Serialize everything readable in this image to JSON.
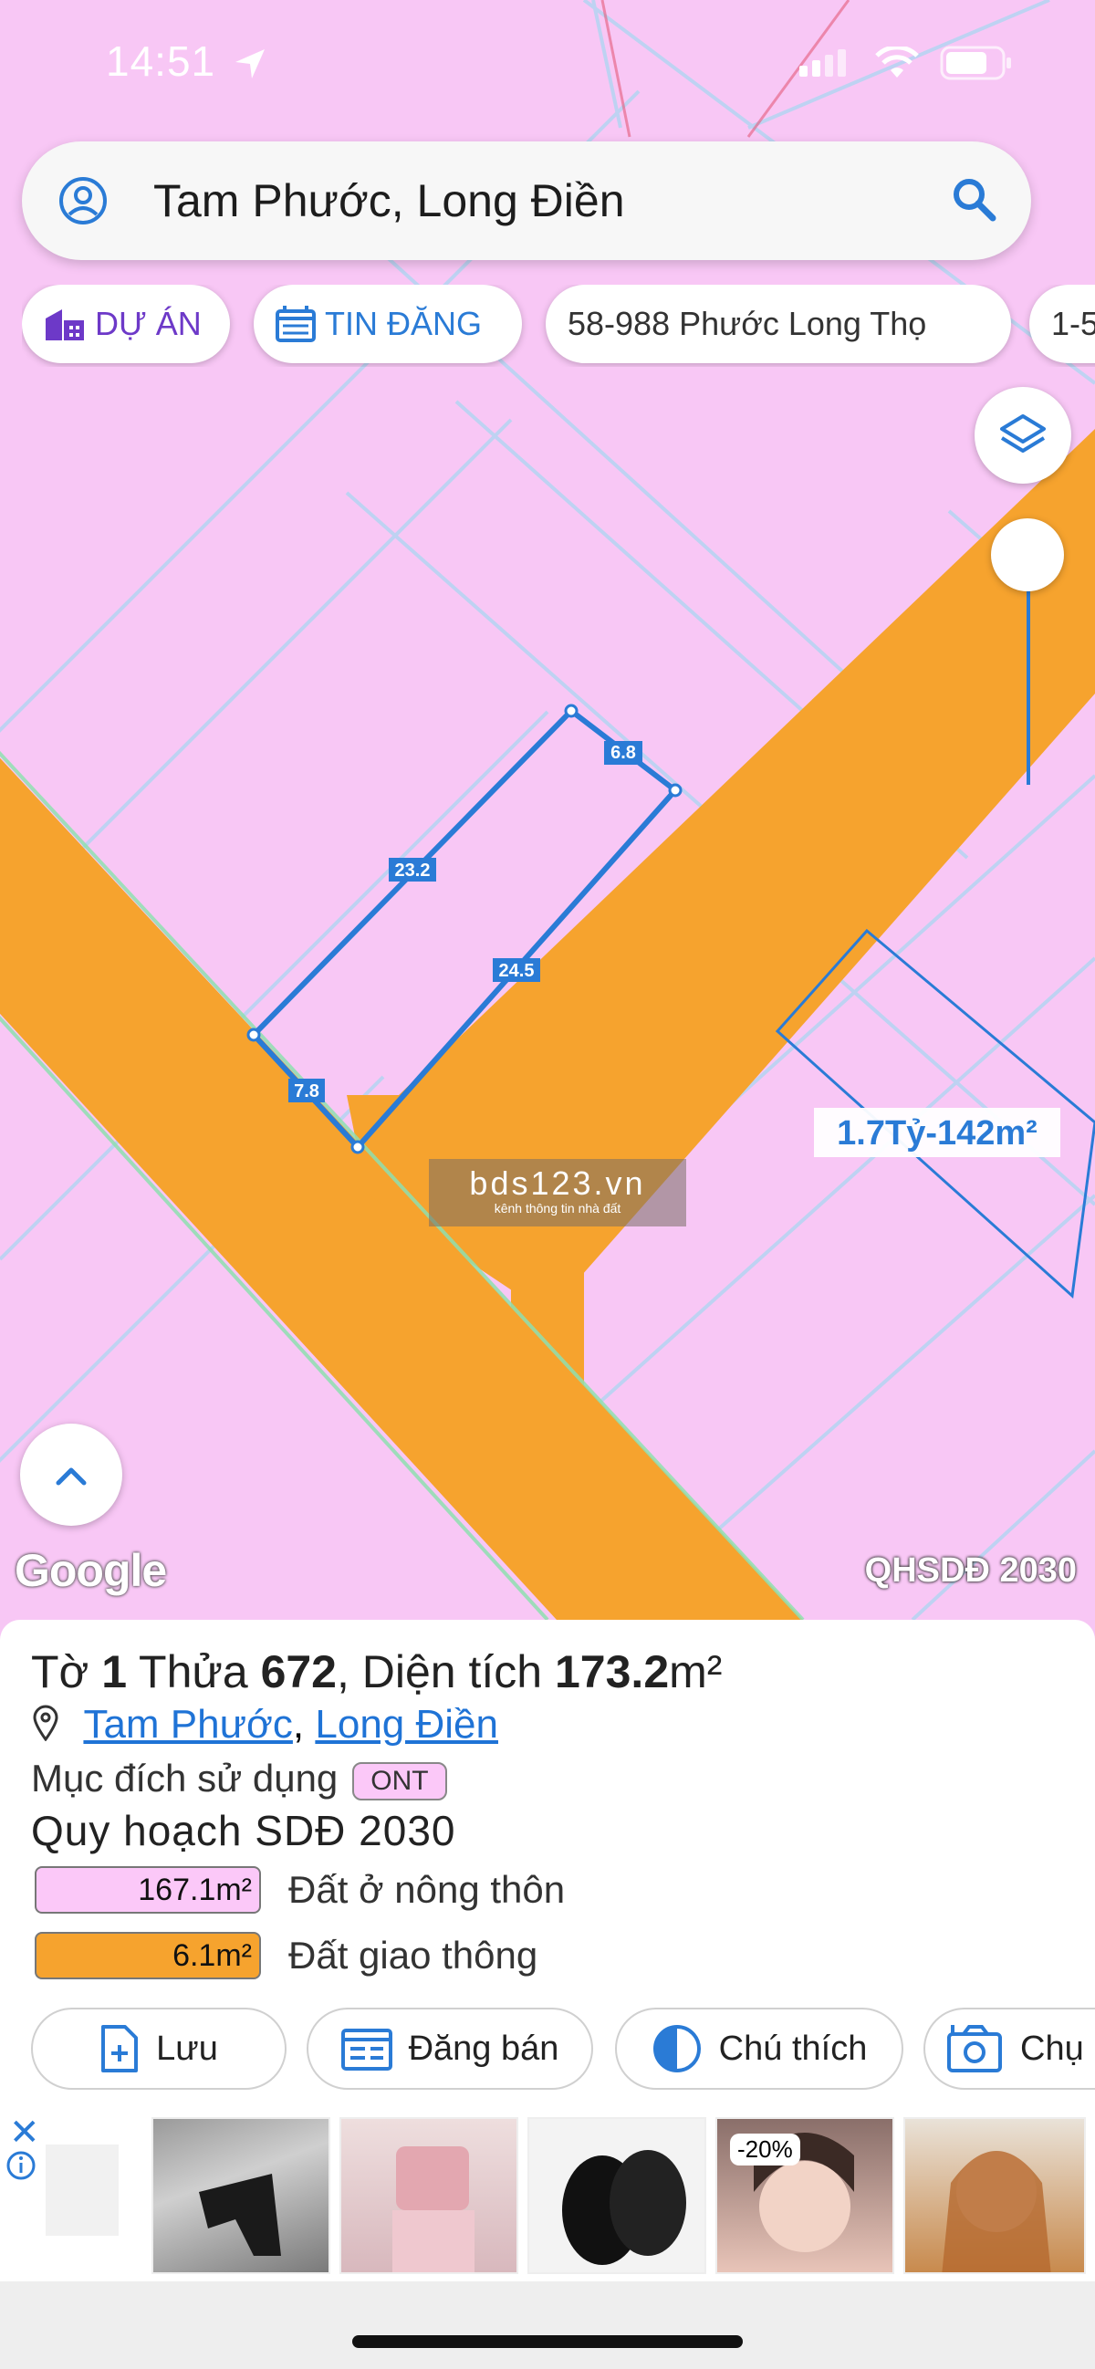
{
  "status": {
    "time": "14:51"
  },
  "search": {
    "query": "Tam Phước, Long Điền"
  },
  "chips": [
    {
      "label": "DỰ ÁN",
      "icon": "building-icon"
    },
    {
      "label": "TIN ĐĂNG",
      "icon": "calendar-list-icon"
    },
    {
      "label": "58-988 Phước Long Thọ"
    },
    {
      "label": "1-5"
    }
  ],
  "map": {
    "edge_labels": [
      "6.8",
      "23.2",
      "24.5",
      "7.8"
    ],
    "listing_label": "1.7Tỷ-142m²",
    "watermark_title": "bds123.vn",
    "watermark_sub": "kênh thông tin nhà đất",
    "google_logo": "Google",
    "plan_label": "QHSDĐ 2030",
    "colors": {
      "residential": "#f8c7f5",
      "road": "#f6a32e",
      "parcel_line": "#2a7bd6",
      "grid_line": "#b8d4f2"
    }
  },
  "panel": {
    "parcel_prefix": "Tờ ",
    "sheet_no": "1",
    "parcel_mid": " Thửa ",
    "plot_no": "672",
    "area_prefix": ", Diện tích ",
    "area_value": "173.2",
    "area_unit": "m²",
    "ward": "Tam Phước",
    "separator": ", ",
    "district": "Long Điền",
    "purpose_label": "Mục đích sử dụng",
    "purpose_code": "ONT",
    "plan_title": "Quy hoạch SDĐ 2030",
    "land_use": [
      {
        "area": "167.1m²",
        "label": "Đất ở nông thôn",
        "color": "#fbc8f8"
      },
      {
        "area": "6.1m²",
        "label": "Đất giao thông",
        "color": "#f6a32e"
      }
    ]
  },
  "actions": [
    {
      "label": "Lưu",
      "icon": "add-file-icon"
    },
    {
      "label": "Đăng bán",
      "icon": "listing-icon"
    },
    {
      "label": "Chú thích",
      "icon": "contrast-icon"
    },
    {
      "label": "Chụ",
      "icon": "camera-icon"
    }
  ],
  "ad": {
    "discount_tag": "-20%"
  }
}
